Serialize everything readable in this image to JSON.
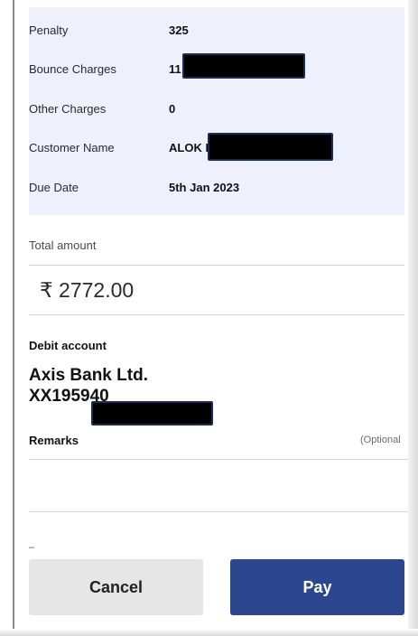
{
  "details": {
    "penalty": {
      "label": "Penalty",
      "value": "325"
    },
    "bounce": {
      "label": "Bounce Charges",
      "value": "11"
    },
    "other": {
      "label": "Other Charges",
      "value": "0"
    },
    "customer": {
      "label": "Customer Name",
      "value": "ALOK P"
    },
    "due": {
      "label": "Due Date",
      "value": "5th Jan 2023"
    }
  },
  "total": {
    "label": "Total amount",
    "value": "₹ 2772.00"
  },
  "debit": {
    "label": "Debit account",
    "bank": "Axis Bank Ltd.",
    "account": "XX195940"
  },
  "remarks": {
    "label": "Remarks",
    "optional": "(Optional",
    "placeholder": ""
  },
  "stray_text": "–",
  "buttons": {
    "cancel": "Cancel",
    "pay": "Pay"
  },
  "colors": {
    "panel": "#eef0fb",
    "pay_button": "#2d4690",
    "cancel_button": "#e6e6e6"
  }
}
